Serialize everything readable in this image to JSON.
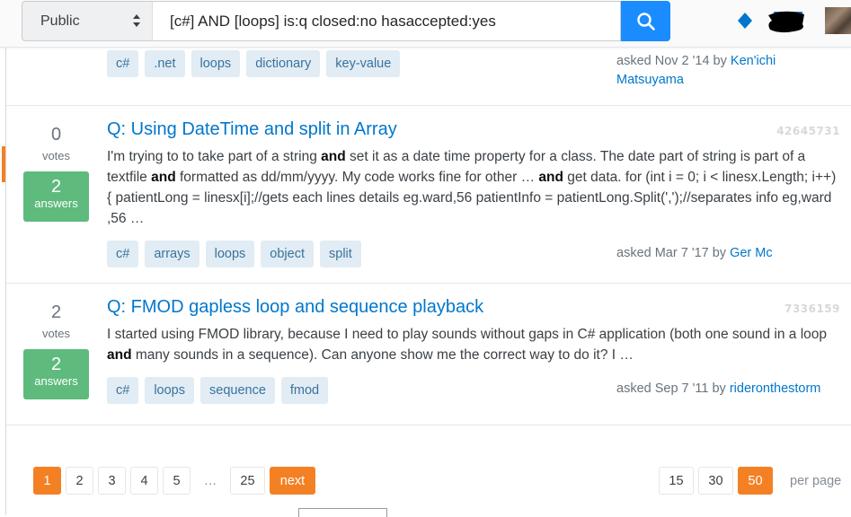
{
  "topbar": {
    "scope": "Public",
    "search_query": "[c#] AND [loops] is:q closed:no hasaccepted:yes",
    "icons": {
      "search": "search-icon",
      "achievement": "diamond-icon"
    }
  },
  "results": [
    {
      "tags": [
        "c#",
        ".net",
        "loops",
        "dictionary",
        "key-value"
      ],
      "asked_prefix": "asked Nov 2 '14 by",
      "author": "Ken'ichi Matsuyama"
    },
    {
      "votes": "0",
      "votes_label": "votes",
      "answers": "2",
      "answers_label": "answers",
      "title": "Q: Using DateTime and split in Array",
      "id": "42645731",
      "excerpt_parts": [
        {
          "t": "I'm trying to to take part of a string ",
          "b": false
        },
        {
          "t": "and",
          "b": true
        },
        {
          "t": " set it as a date time property for a class. The date part of string is part of a textfile ",
          "b": false
        },
        {
          "t": "and",
          "b": true
        },
        {
          "t": " formatted as dd/mm/yyyy. My code works fine for other … ",
          "b": false
        },
        {
          "t": "and",
          "b": true
        },
        {
          "t": " get data. for (int i = 0; i < linesx.Length; i++) { patientLong = linesx[i];//gets each lines details eg.ward,56 patientInfo = patientLong.Split(',');//separates info eg,ward ,56 …",
          "b": false
        }
      ],
      "tags": [
        "c#",
        "arrays",
        "loops",
        "object",
        "split"
      ],
      "asked_prefix": "asked Mar 7 '17 by",
      "author": "Ger Mc"
    },
    {
      "votes": "2",
      "votes_label": "votes",
      "answers": "2",
      "answers_label": "answers",
      "title": "Q: FMOD gapless loop and sequence playback",
      "id": "7336159",
      "excerpt_parts": [
        {
          "t": "I started using FMOD library, because I need to play sounds without gaps in C# application (both one sound in a loop ",
          "b": false
        },
        {
          "t": "and",
          "b": true
        },
        {
          "t": " many sounds in a sequence). Can anyone show me the correct way to do it? I …",
          "b": false
        }
      ],
      "tags": [
        "c#",
        "loops",
        "sequence",
        "fmod"
      ],
      "asked_prefix": "asked Sep 7 '11 by",
      "author": "rideronthestorm"
    }
  ],
  "pagination": {
    "pages": [
      "1",
      "2",
      "3",
      "4",
      "5"
    ],
    "ellipsis": "…",
    "last_page": "25",
    "next_label": "next",
    "current_page": "1"
  },
  "page_size": {
    "options": [
      "15",
      "30",
      "50"
    ],
    "selected": "50",
    "label": "per page"
  },
  "colors": {
    "accent_orange": "#f48024",
    "link_blue": "#0077cc",
    "search_blue": "#1a8cff",
    "answered_green": "#5eba7d",
    "tag_bg": "#e1ecf4"
  }
}
